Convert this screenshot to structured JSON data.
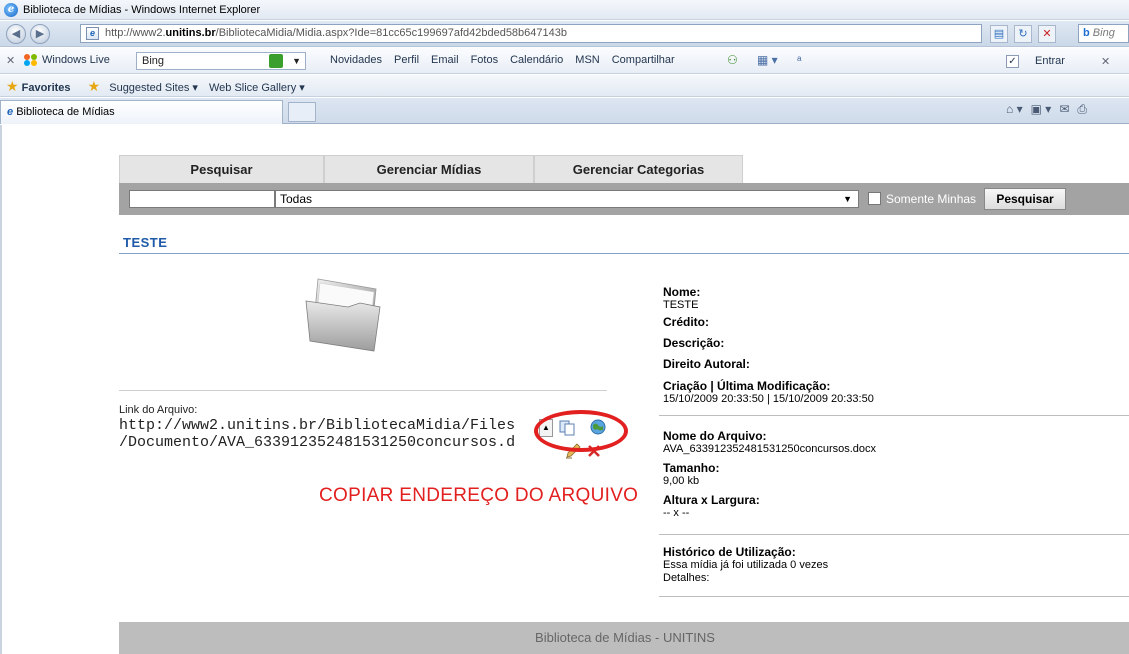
{
  "window": {
    "title": "Biblioteca de Mídias - Windows Internet Explorer",
    "url_prefix": "http://www2.",
    "url_domain": "unitins.br",
    "url_path": "/BibliotecaMidia/Midia.aspx?Ide=81cc65c199697afd42bded58b647143b",
    "search_placeholder": "Bing"
  },
  "live_toolbar": {
    "brand": "Windows Live",
    "search_value": "Bing",
    "links": [
      "Novidades",
      "Perfil",
      "Email",
      "Fotos",
      "Calendário",
      "MSN",
      "Compartilhar"
    ],
    "signin": "Entrar"
  },
  "favorites_bar": {
    "favorites": "Favorites",
    "suggested": "Suggested Sites ▾",
    "gallery": "Web Slice Gallery ▾"
  },
  "browser_tab": {
    "label": "Biblioteca de Mídias"
  },
  "app": {
    "tabs": [
      "Pesquisar",
      "Gerenciar Mídias",
      "Gerenciar Categorias"
    ],
    "search": {
      "input_value": "",
      "category_selected": "Todas",
      "only_mine_label": "Somente Minhas",
      "button": "Pesquisar"
    },
    "section_title": "TESTE",
    "link_label": "Link do Arquivo:",
    "link_line1": "http://www2.unitins.br/BibliotecaMidia/Files",
    "link_line2": "/Documento/AVA_633912352481531250concursos.d",
    "annotation": "COPIAR ENDEREÇO DO ARQUIVO",
    "details": {
      "nome_label": "Nome:",
      "nome_value": "TESTE",
      "credito_label": "Crédito:",
      "descricao_label": "Descrição:",
      "direito_label": "Direito Autoral:",
      "criacao_label": "Criação | Última Modificação:",
      "criacao_value": "15/10/2009 20:33:50 | 15/10/2009 20:33:50",
      "arquivo_label": "Nome do Arquivo:",
      "arquivo_value": "AVA_633912352481531250concursos.docx",
      "tamanho_label": "Tamanho:",
      "tamanho_value": "9,00 kb",
      "dimensoes_label": "Altura x Largura:",
      "dimensoes_value": "-- x --",
      "historico_label": "Histórico de Utilização:",
      "historico_value": "Essa mídia já foi utilizada 0 vezes",
      "detalhes_label": "Detalhes:"
    },
    "footer": "Biblioteca de Mídias - UNITINS"
  },
  "colors": {
    "accent_blue": "#1e5aa8",
    "annotation_red": "#e2201f",
    "search_bar_gray": "#a3a3a3",
    "footer_gray": "#bdbdbd"
  },
  "icons": [
    "ie-logo-icon",
    "back-icon",
    "forward-icon",
    "page-icon",
    "refresh-icon",
    "stop-icon",
    "star-icon",
    "folder-icon",
    "copy-icon",
    "globe-icon",
    "edit-icon",
    "delete-icon"
  ]
}
